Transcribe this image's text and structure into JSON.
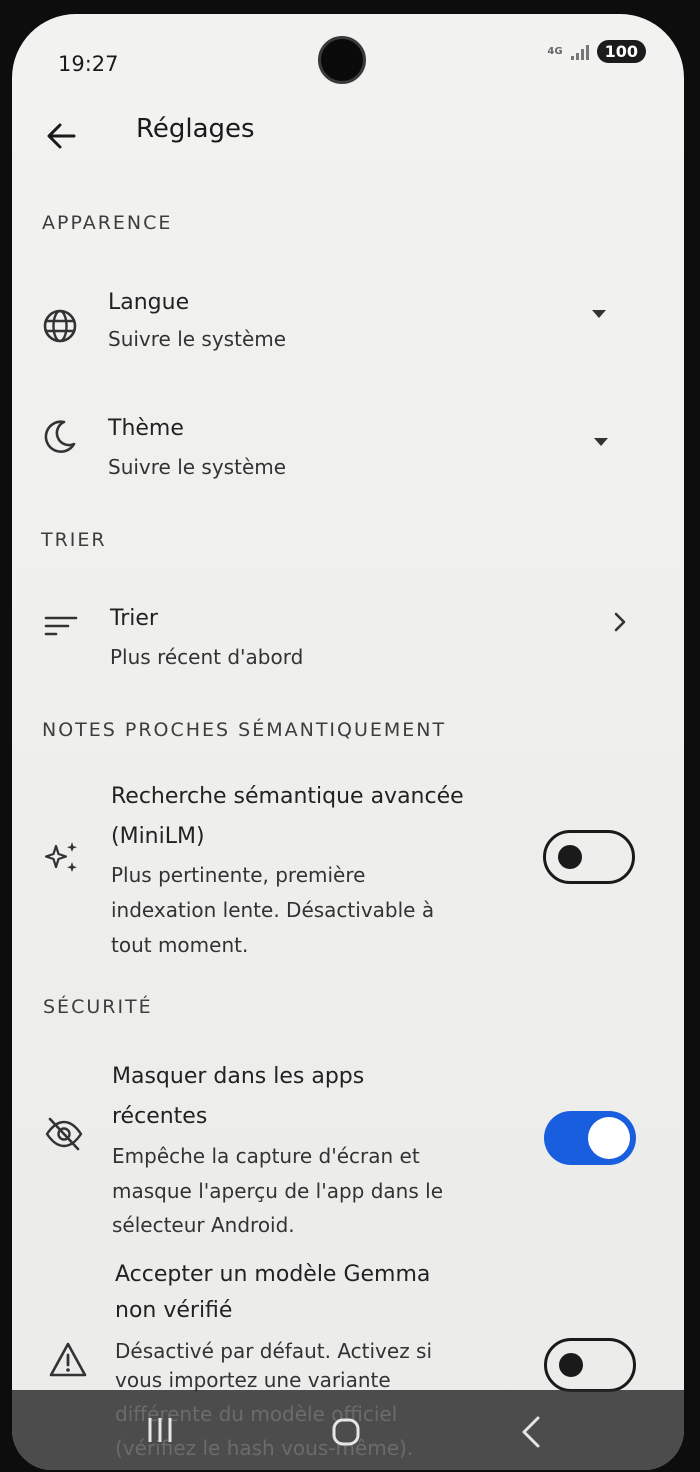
{
  "status": {
    "time": "19:27",
    "network": "4G",
    "battery": "100"
  },
  "header": {
    "title": "Réglages"
  },
  "sections": {
    "appearance": "APPARENCE",
    "sort": "TRIER",
    "semantic": "NOTES PROCHES SÉMANTIQUEMENT",
    "security": "SÉCURITÉ"
  },
  "items": {
    "language": {
      "title": "Langue",
      "subtitle": "Suivre le système",
      "icon": "globe-icon"
    },
    "theme": {
      "title": "Thème",
      "subtitle": "Suivre le système",
      "icon": "moon-icon"
    },
    "sort": {
      "title": "Trier",
      "subtitle": "Plus récent d'abord",
      "icon": "sort-lines-icon"
    },
    "semantic": {
      "title_line1": "Recherche sémantique avancée",
      "title_line2": "(MiniLM)",
      "sub_line1": "Plus pertinente, première",
      "sub_line2": "indexation lente. Désactivable à",
      "sub_line3": "tout moment.",
      "enabled": false,
      "icon": "sparkles-icon"
    },
    "hide_recent": {
      "title_line1": "Masquer dans les apps",
      "title_line2": "récentes",
      "sub_line1": "Empêche la capture d'écran et",
      "sub_line2": "masque l'aperçu de l'app dans le",
      "sub_line3": "sélecteur Android.",
      "enabled": true,
      "icon": "eye-off-icon"
    },
    "gemma": {
      "title_line1": "Accepter un modèle Gemma",
      "title_line2": "non vérifié",
      "sub_line1": "Désactivé par défaut. Activez si",
      "sub_line2": "vous importez une variante",
      "sub_line3": "différente du modèle officiel",
      "sub_line4": "(vérifiez le hash vous-même).",
      "enabled": false,
      "icon": "warning-icon"
    }
  },
  "colors": {
    "accent": "#1a5ee0",
    "background": "#efefed",
    "text": "#222222"
  }
}
